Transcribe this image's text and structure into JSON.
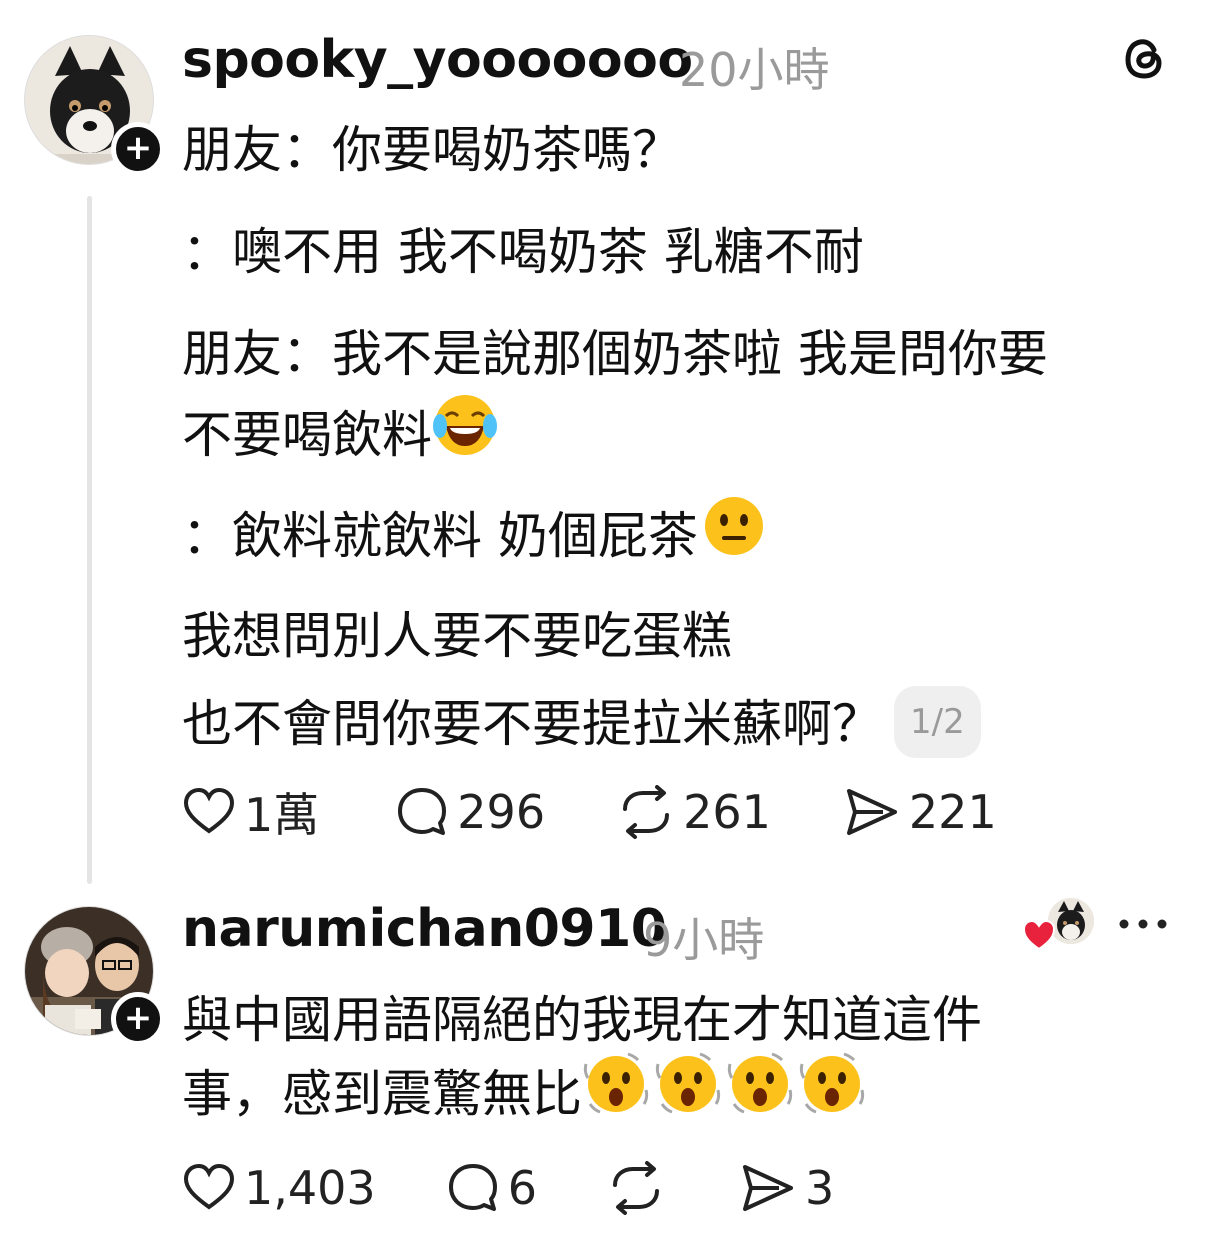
{
  "post": {
    "username": "spooky_yooooooo",
    "time": "20小時",
    "lines": [
      "朋友：你要喝奶茶嗎？",
      "：噢不用 我不喝奶茶 乳糖不耐",
      "朋友：我不是說那個奶茶啦 我是問你要",
      "不要喝飲料",
      "：飲料就飲料 奶個屁茶",
      "我想問別人要不要吃蛋糕",
      "也不會問你要不要提拉米蘇啊？"
    ],
    "page_badge": "1/2",
    "likes": "1萬",
    "comments": "296",
    "reposts": "261",
    "shares": "221"
  },
  "reply": {
    "username": "narumichan0910",
    "time": "9小時",
    "lines": [
      "與中國用語隔絕的我現在才知道這件",
      "事，感到震驚無比"
    ],
    "likes": "1,403",
    "comments": "6",
    "shares": "3"
  },
  "colors": {
    "muted": "#9a9a9a",
    "like_heart": "#e8213c",
    "thread_line": "#e4e4e4"
  },
  "icons": [
    "threads-logo-icon",
    "heart-icon",
    "comment-icon",
    "repost-icon",
    "share-icon",
    "more-icon",
    "laughing-tears-emoji",
    "neutral-face-emoji",
    "astonished-emoji"
  ]
}
